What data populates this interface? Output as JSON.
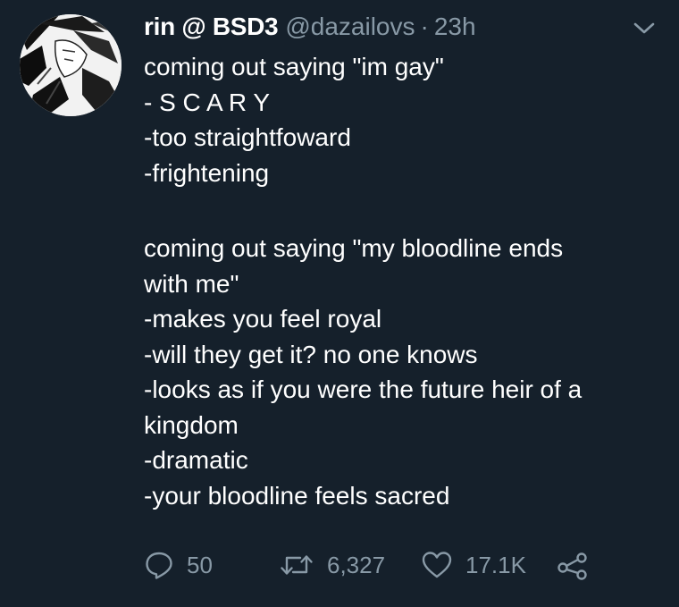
{
  "tweet": {
    "display_name": "rin @ BSD3",
    "handle": "@dazailovs",
    "separator": "·",
    "timestamp": "23h",
    "avatar": "profile-picture",
    "menu_icon": "chevron-down-icon",
    "lines": [
      "coming out saying \"im gay\"",
      "- S C A R Y",
      "-too straightfoward",
      "-frightening",
      "",
      "coming out saying \"my bloodline ends",
      "with me\"",
      "-makes you feel royal",
      "-will they get it? no one knows",
      "-looks as if you were the future heir of a",
      "kingdom",
      "-dramatic",
      "-your bloodline feels sacred"
    ],
    "actions": {
      "reply": {
        "icon": "reply-icon",
        "count": "50"
      },
      "retweet": {
        "icon": "retweet-icon",
        "count": "6,327"
      },
      "like": {
        "icon": "heart-icon",
        "count": "17.1K"
      },
      "share": {
        "icon": "share-icon"
      }
    }
  },
  "colors": {
    "background": "#15202b",
    "text": "#ffffff",
    "secondary": "#8899a6"
  }
}
